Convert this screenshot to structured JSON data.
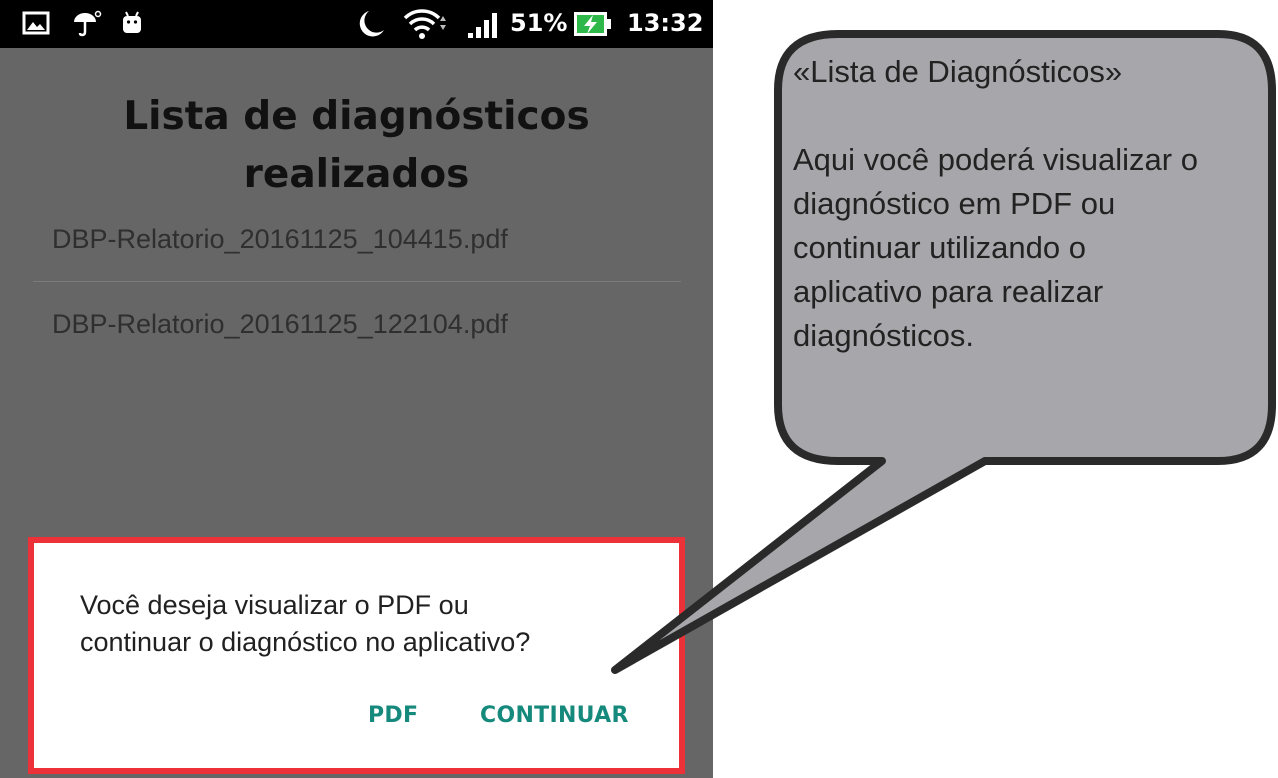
{
  "status_bar": {
    "icons_left": [
      "image-icon",
      "umbrella-icon",
      "android-icon"
    ],
    "icons_right": [
      "moon-icon",
      "wifi-icon",
      "signal-icon"
    ],
    "battery_percent": "51%",
    "time": "13:32"
  },
  "screen": {
    "title_line1": "Lista de diagnósticos",
    "title_line2": "realizados",
    "files": [
      "DBP-Relatorio_20161125_104415.pdf",
      "DBP-Relatorio_20161125_122104.pdf"
    ]
  },
  "dialog": {
    "message_line1": "Você deseja visualizar o PDF ou",
    "message_line2": "continuar o diagnóstico no aplicativo?",
    "pdf_label": "PDF",
    "continue_label": "CONTINUAR",
    "highlight_color": "#ec3138",
    "button_color": "#14897c"
  },
  "callout": {
    "heading": "«Lista de Diagnósticos»",
    "body_lines": [
      "Aqui você poderá visualizar o",
      "diagnóstico em PDF ou",
      "continuar utilizando o",
      "aplicativo para realizar",
      "diagnósticos."
    ],
    "fill_color": "#a7a7ab"
  }
}
